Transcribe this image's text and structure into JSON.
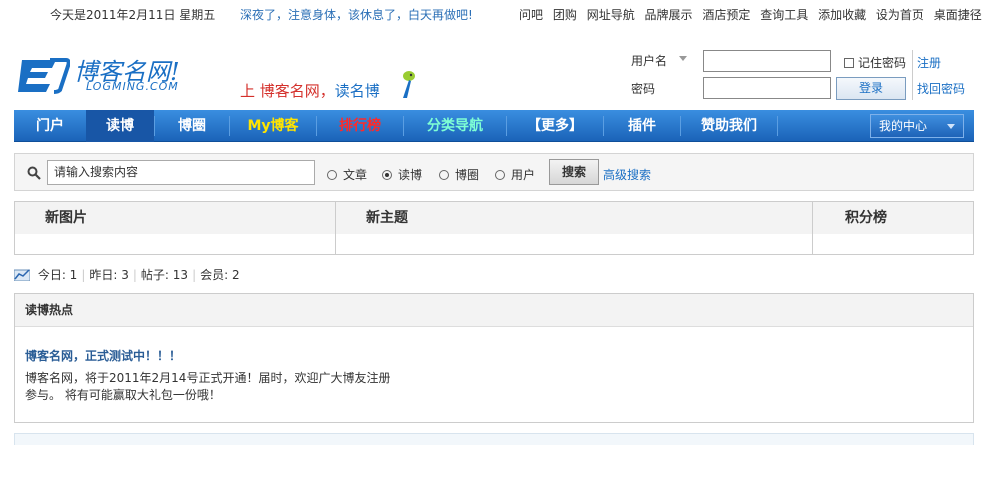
{
  "topbar": {
    "date": "今天是2011年2月11日 星期五",
    "slogan": "深夜了，注意身体，该休息了，白天再做吧!",
    "links": [
      "问吧",
      "团购",
      "网址导航",
      "品牌展示",
      "酒店预定",
      "查询工具",
      "添加收藏",
      "设为首页",
      "桌面捷径"
    ]
  },
  "header": {
    "logo_name": "博客名网!",
    "logo_sub": "LOGMING.COM",
    "tagline_prefix": "上 ",
    "tagline_red": "博客名网，",
    "tagline_blue": "读名博"
  },
  "login": {
    "username_label": "用户名",
    "password_label": "密码",
    "remember_label": "记住密码",
    "login_button": "登录",
    "register_link": "注册",
    "forgot_link": "找回密码"
  },
  "nav": {
    "items": [
      {
        "label": "门户",
        "color": "#ffffff"
      },
      {
        "label": "读博",
        "color": "#ffffff"
      },
      {
        "label": "博圈",
        "color": "#ffffff"
      },
      {
        "label": "My博客",
        "color": "#ffe400"
      },
      {
        "label": "排行榜",
        "color": "#ff2a2a"
      },
      {
        "label": "分类导航",
        "color": "#7fffd4"
      },
      {
        "label": "【更多】",
        "color": "#ffffff"
      },
      {
        "label": "插件",
        "color": "#ffffff"
      },
      {
        "label": "赞助我们",
        "color": "#ffffff"
      }
    ],
    "active_index": 1,
    "my_center": "我的中心"
  },
  "search": {
    "placeholder": "请输入搜索内容",
    "options": [
      "文章",
      "读博",
      "博圈",
      "用户"
    ],
    "selected_index": 1,
    "button": "搜索",
    "advanced": "高级搜索"
  },
  "columns": {
    "new_images": "新图片",
    "new_topics": "新主题",
    "ranking": "积分榜"
  },
  "stats": {
    "today": "今日: 1",
    "yesterday": "昨日: 3",
    "posts": "帖子: 13",
    "members": "会员: 2"
  },
  "hot": {
    "header": "读博热点",
    "title": "博客名网，正式测试中！！！",
    "body_line1": "博客名网，将于2011年2月14号正式开通！届时，欢迎广大博友注册",
    "body_line2": "参与。 将有可能赢取大礼包一份哦！"
  },
  "colors": {
    "brand_blue": "#1a6fc4",
    "nav_blue": "#1b63b8"
  }
}
